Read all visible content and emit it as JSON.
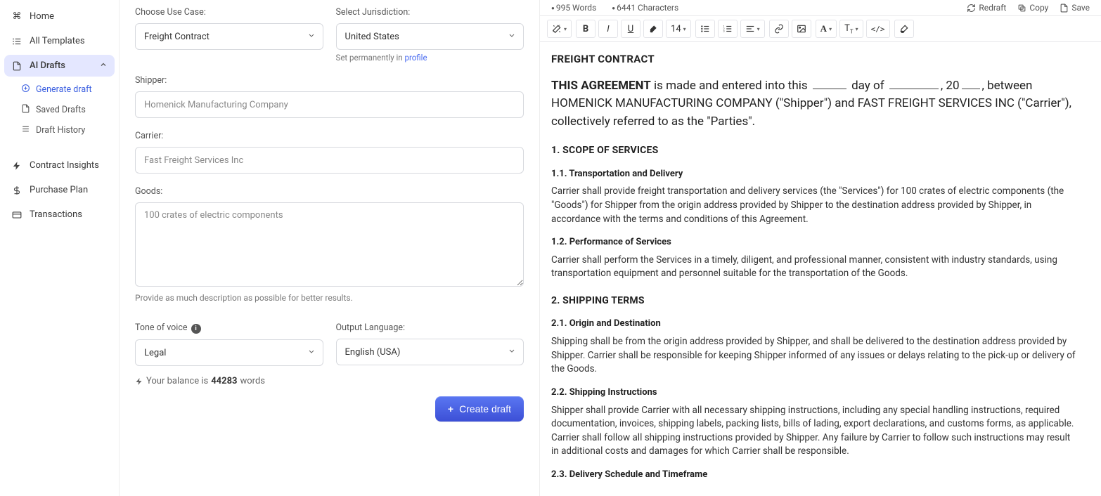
{
  "sidebar": {
    "home": "Home",
    "all_templates": "All Templates",
    "ai_drafts": "AI Drafts",
    "generate_draft": "Generate draft",
    "saved_drafts": "Saved Drafts",
    "draft_history": "Draft History",
    "contract_insights": "Contract Insights",
    "purchase_plan": "Purchase Plan",
    "transactions": "Transactions"
  },
  "form": {
    "use_case_label": "Choose Use Case:",
    "use_case_value": "Freight Contract",
    "jurisdiction_label": "Select Jurisdiction:",
    "jurisdiction_value": "United States",
    "jurisdiction_hint_prefix": "Set permanently in ",
    "jurisdiction_hint_link": "profile",
    "shipper_label": "Shipper:",
    "shipper_value": "Homenick Manufacturing Company",
    "carrier_label": "Carrier:",
    "carrier_value": "Fast Freight Services Inc",
    "goods_label": "Goods:",
    "goods_value": "100 crates of electric components",
    "goods_help": "Provide as much description as possible for better results.",
    "tone_label": "Tone of voice ",
    "tone_value": "Legal",
    "lang_label": "Output Language:",
    "lang_value": "English (USA)",
    "balance_prefix": "Your balance is ",
    "balance_count": "44283",
    "balance_suffix": " words",
    "create_btn": "Create draft"
  },
  "editor": {
    "words": "995 Words",
    "chars": "6441 Characters",
    "redraft": "Redraft",
    "copy": "Copy",
    "save": "Save",
    "font_size": "14"
  },
  "doc": {
    "title": "FREIGHT CONTRACT",
    "agreement_lead": "THIS AGREEMENT",
    "agreement_mid1": " is made and entered into this ",
    "agreement_mid2": " day of ",
    "agreement_mid3": ", 20",
    "agreement_tail": ", between HOMENICK MANUFACTURING COMPANY (\"Shipper\") and FAST FREIGHT SERVICES INC (\"Carrier\"), collectively referred to as the \"Parties\".",
    "s1": "1. SCOPE OF SERVICES",
    "s1_1": "1.1. Transportation and Delivery",
    "p1_1": "Carrier shall provide freight transportation and delivery services (the \"Services\") for 100 crates of electric components (the \"Goods\") for Shipper from the origin address provided by Shipper to the destination address provided by Shipper, in accordance with the terms and conditions of this Agreement.",
    "s1_2": "1.2. Performance of Services",
    "p1_2": "Carrier shall perform the Services in a timely, diligent, and professional manner, consistent with industry standards, using transportation equipment and personnel suitable for the transportation of the Goods.",
    "s2": "2. SHIPPING TERMS",
    "s2_1": "2.1. Origin and Destination",
    "p2_1": "Shipping shall be from the origin address provided by Shipper, and shall be delivered to the destination address provided by Shipper. Carrier shall be responsible for keeping Shipper informed of any issues or delays relating to the pick-up or delivery of the Goods.",
    "s2_2": "2.2. Shipping Instructions",
    "p2_2": "Shipper shall provide Carrier with all necessary shipping instructions, including any special handling instructions, required documentation, invoices, shipping labels, packing lists, bills of lading, export declarations, and customs forms, as applicable. Carrier shall follow all shipping instructions provided by Shipper. Any failure by Carrier to follow such instructions may result in additional costs and damages for which Carrier shall be responsible.",
    "s2_3": "2.3. Delivery Schedule and Timeframe"
  }
}
